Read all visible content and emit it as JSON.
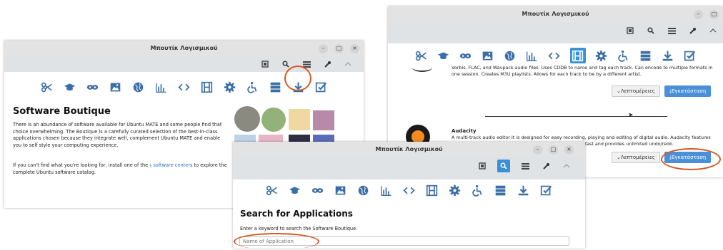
{
  "window_title": "Μπουτίκ Λογισμικού",
  "buttons": {
    "minimize": "–",
    "maximize": "□",
    "close": "×"
  },
  "boutique": {
    "heading": "Software Boutique",
    "intro": "There is an abundance of software available for Ubuntu MATE and some people find that choice overwhelming. The Boutique is a carefully curated selection of the best-in-class applications chosen because they integrate well, complement Ubuntu MATE and enable you to self style your computing experience.",
    "footer_before": "If you can't find what you're looking for, install one of the",
    "footer_link": "software centers",
    "footer_after": "to explore the complete Ubuntu software catalog."
  },
  "apps_view": {
    "app1_desc": "Vorbis, FLAC, and Wavpack audio files. Uses CDDB to name and tag each track. Can encode to multiple formats in one session. Creates M3U playlists. Allows for each track to be by a different artist.",
    "app2_name": "Audacity",
    "app2_desc": "A multi-track audio editor It is designed for easy recording, playing and editing of digital audio. Audacity features digital effects and spectrum analysis tools. Editing is very fast and provides unlimited undo/redo.",
    "details_label": "Λεπτομέρειες",
    "install_label": "Εγκατάσταση"
  },
  "search_view": {
    "heading": "Search for Applications",
    "subtitle": "Enter a keyword to search the Software Boutique.",
    "placeholder": "Name of Application"
  },
  "colors": {
    "accent": "#3b8fd6",
    "highlight_circle": "#d45a26",
    "install_button": "#4a90d9"
  }
}
